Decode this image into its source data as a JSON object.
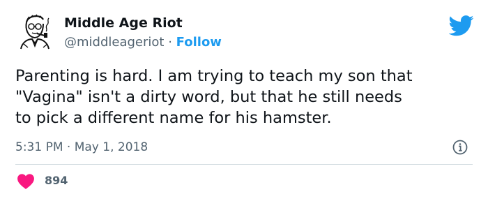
{
  "tweet": {
    "author_name": "Middle Age Riot",
    "handle": "@middleageriot",
    "separator": "·",
    "follow_label": "Follow",
    "text": "Parenting is hard. I am trying to teach my son that\n\"Vagina\" isn't a dirty word, but that he still needs\nto pick a different name for his hamster.",
    "timestamp": "5:31 PM · May 1, 2018",
    "likes": "894"
  },
  "icons": {
    "avatar": "avatar-sketch-man-pipe",
    "brand": "twitter-bird-icon",
    "info": "info-icon",
    "like": "heart-icon"
  },
  "colors": {
    "accent": "#1d9bf0",
    "heart": "#f91880",
    "muted": "#536471",
    "text": "#0f1419",
    "divider": "#cfd9de"
  }
}
